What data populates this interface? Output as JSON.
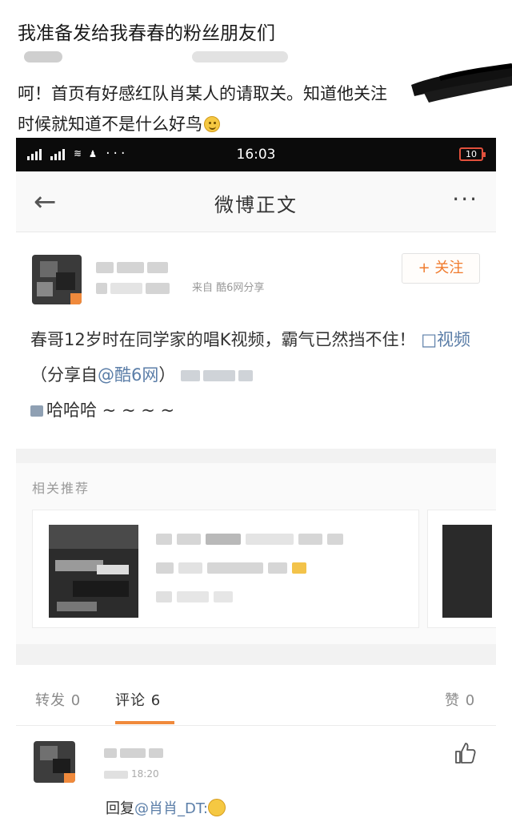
{
  "outer": {
    "title": "我准备发给我春春的粉丝朋友们",
    "text_line1": "呵！首页有好感红队肖某人的请取关。知道他关注",
    "text_line2": "时候就知道不是什么好鸟"
  },
  "status_bar": {
    "time": "16:03",
    "battery": "10"
  },
  "nav": {
    "back": "←",
    "title": "微博正文",
    "more": "···"
  },
  "post": {
    "source": "来自 酷6网分享",
    "follow_label": "+ 关注",
    "body_text": "春哥12岁时在同学家的唱K视频，霸气已然挡不住！",
    "video_link": "□视频",
    "share_prefix": "（分享自",
    "share_link": "@酷6网",
    "share_suffix": "）",
    "body_end": "哈哈哈 ~ ~ ~ ~"
  },
  "related": {
    "title": "相关推荐"
  },
  "tabs": {
    "repost": "转发 0",
    "comments": "评论 6",
    "likes": "赞 0"
  },
  "comment": {
    "time": "18:20",
    "reply_prefix": "回复",
    "reply_link": "@肖肖_DT:"
  },
  "colors": {
    "accent": "#f08a3c",
    "link": "#5b7ea8",
    "status_bar": "#0b0b0b"
  }
}
